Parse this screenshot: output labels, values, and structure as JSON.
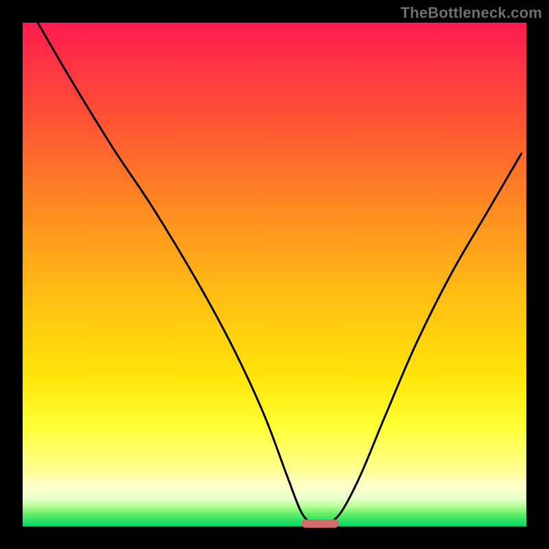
{
  "watermark": "TheBottleneck.com",
  "colors": {
    "background": "#000000",
    "curve_stroke": "#000000",
    "marker_fill": "#d46a6a"
  },
  "chart_data": {
    "type": "line",
    "title": "",
    "xlabel": "",
    "ylabel": "",
    "xlim": [
      0,
      100
    ],
    "ylim": [
      0,
      100
    ],
    "grid": false,
    "legend": false,
    "series": [
      {
        "name": "bottleneck-curve",
        "x": [
          3,
          10,
          18,
          26,
          35,
          42,
          48,
          52.5,
          55.5,
          58,
          60,
          63,
          67,
          72,
          78,
          85,
          92,
          99
        ],
        "y": [
          100,
          88,
          75,
          63,
          48,
          35,
          22,
          10,
          2.5,
          0.5,
          0.5,
          2.5,
          10,
          22,
          36,
          50,
          62,
          74
        ]
      }
    ],
    "annotations": [
      {
        "type": "rounded-bar",
        "name": "minimum-marker",
        "x_center": 59,
        "y": 0.5,
        "width_pct": 7.5,
        "height_pct": 1.6
      }
    ],
    "gradient_stops": [
      {
        "pct": 0,
        "color": "#ff1a4d"
      },
      {
        "pct": 8,
        "color": "#ff3344"
      },
      {
        "pct": 20,
        "color": "#ff5533"
      },
      {
        "pct": 36,
        "color": "#ff8822"
      },
      {
        "pct": 52,
        "color": "#ffb814"
      },
      {
        "pct": 70,
        "color": "#ffe408"
      },
      {
        "pct": 80,
        "color": "#ffff33"
      },
      {
        "pct": 88,
        "color": "#ffff88"
      },
      {
        "pct": 92,
        "color": "#ffffcc"
      },
      {
        "pct": 94.5,
        "color": "#e8ffcc"
      },
      {
        "pct": 96,
        "color": "#b8ff99"
      },
      {
        "pct": 97.5,
        "color": "#66ee66"
      },
      {
        "pct": 100,
        "color": "#00d966"
      }
    ]
  }
}
